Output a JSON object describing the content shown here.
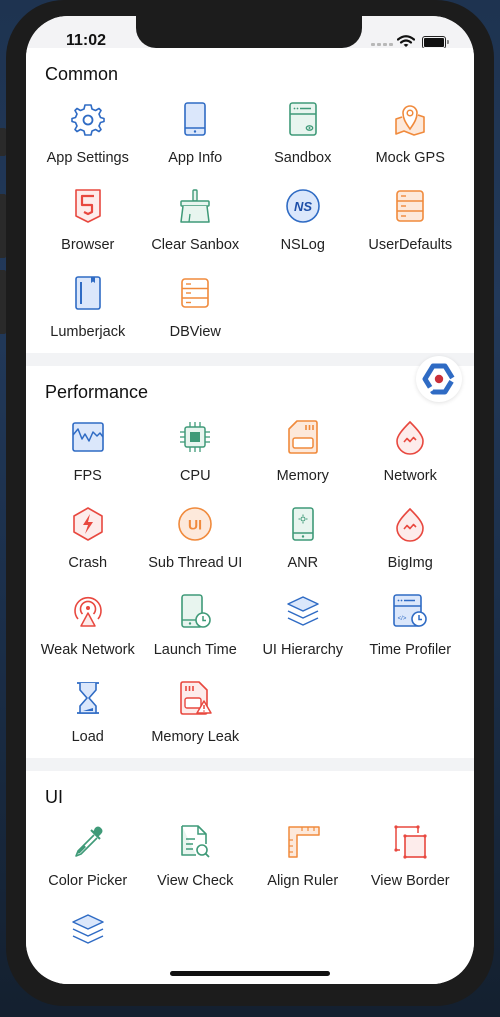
{
  "status_bar": {
    "time": "11:02"
  },
  "colors": {
    "blue": "#2f6bc4",
    "blue_fill": "#dbe7fb",
    "green": "#3f9a78",
    "green_fill": "#e8f5ef",
    "orange": "#f08a3c",
    "orange_fill": "#fde9db",
    "red": "#e8483f",
    "red_fill": "#fdeceb",
    "divider": "#f2f3f5",
    "float_dot": "#c9303a"
  },
  "sections": [
    {
      "title": "Common",
      "items": [
        {
          "label": "App Settings",
          "icon": "gear-icon"
        },
        {
          "label": "App Info",
          "icon": "phone-icon"
        },
        {
          "label": "Sandbox",
          "icon": "sandbox-icon"
        },
        {
          "label": "Mock GPS",
          "icon": "map-pin-icon"
        },
        {
          "label": "Browser",
          "icon": "html5-icon"
        },
        {
          "label": "Clear Sanbox",
          "icon": "broom-icon"
        },
        {
          "label": "NSLog",
          "icon": "nslog-icon",
          "icon_text": "NS"
        },
        {
          "label": "UserDefaults",
          "icon": "storage-icon"
        },
        {
          "label": "Lumberjack",
          "icon": "notebook-icon"
        },
        {
          "label": "DBView",
          "icon": "database-icon"
        }
      ]
    },
    {
      "title": "Performance",
      "items": [
        {
          "label": "FPS",
          "icon": "fps-chart-icon"
        },
        {
          "label": "CPU",
          "icon": "cpu-chip-icon"
        },
        {
          "label": "Memory",
          "icon": "memory-card-icon"
        },
        {
          "label": "Network",
          "icon": "network-drop-icon"
        },
        {
          "label": "Crash",
          "icon": "crash-bolt-icon"
        },
        {
          "label": "Sub Thread UI",
          "icon": "ui-badge-icon",
          "icon_text": "UI"
        },
        {
          "label": "ANR",
          "icon": "anr-phone-icon"
        },
        {
          "label": "BigImg",
          "icon": "bigimg-drop-icon"
        },
        {
          "label": "Weak Network",
          "icon": "antenna-icon"
        },
        {
          "label": "Launch Time",
          "icon": "phone-clock-icon"
        },
        {
          "label": "UI Hierarchy",
          "icon": "layers-icon"
        },
        {
          "label": "Time Profiler",
          "icon": "code-clock-icon"
        },
        {
          "label": "Load",
          "icon": "hourglass-icon"
        },
        {
          "label": "Memory Leak",
          "icon": "memory-warning-icon"
        }
      ]
    },
    {
      "title": "UI",
      "items": [
        {
          "label": "Color Picker",
          "icon": "eyedropper-icon"
        },
        {
          "label": "View Check",
          "icon": "document-search-icon"
        },
        {
          "label": "Align Ruler",
          "icon": "ruler-icon"
        },
        {
          "label": "View Border",
          "icon": "border-icon"
        },
        {
          "label": "",
          "icon": "layers-icon"
        }
      ]
    }
  ],
  "floating_button": {
    "icon": "doraemon-entry-icon"
  }
}
